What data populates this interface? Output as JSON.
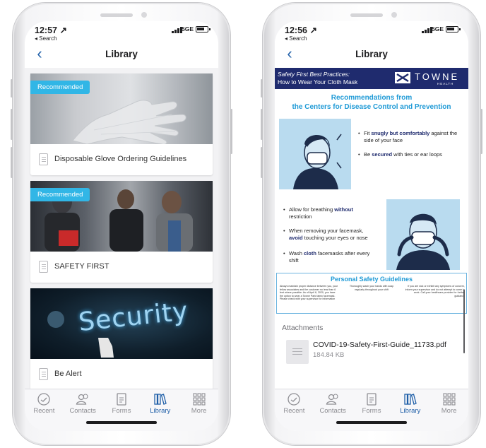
{
  "left_screen": {
    "status": {
      "time": "12:57 ↗",
      "back_app": "◂ Search",
      "network": "5GE"
    },
    "nav": {
      "title": "Library"
    },
    "cards": [
      {
        "badge": "Recommended",
        "title": "Disposable Glove Ordering Guidelines"
      },
      {
        "badge": "Recommended",
        "title": "SAFETY FIRST"
      },
      {
        "badge": "",
        "image_text": "Security",
        "title": "Be Alert"
      }
    ]
  },
  "right_screen": {
    "status": {
      "time": "12:56 ↗",
      "back_app": "◂ Search",
      "network": "5GE"
    },
    "nav": {
      "title": "Library"
    },
    "document": {
      "banner_line1": "Safety First Best Practices:",
      "banner_line2": "How to Wear Your Cloth Mask",
      "logo_text": "TOWNE",
      "logo_sub": "HEALTH",
      "heading_line1": "Recommendations from",
      "heading_line2": "the Centers for Disease Control and Prevention",
      "bullet1_pre": "Fit ",
      "bullet1_bold": "snugly but comfortably",
      "bullet1_post": " against the side of your face",
      "bullet2_pre": "Be ",
      "bullet2_bold": "secured",
      "bullet2_post": " with ties or ear loops",
      "bullet3_pre": "Allow for breathing ",
      "bullet3_bold": "without",
      "bullet3_post": " restriction",
      "bullet4_pre": "When removing your facemask, ",
      "bullet4_bold": "avoid",
      "bullet4_post": " touching your eyes or nose",
      "bullet5_pre": "Wash ",
      "bullet5_bold": "cloth",
      "bullet5_post": " facemasks after every shift",
      "psg_title": "Personal Safety Guidelines",
      "psg_col1": "Always maintain proper distance between you, your fellow associates and the customer no less than 6 feet where possible. As of April 6, 2020, you have the option to wear a Towne Park fabric facemask. Please check with your supervisor for information",
      "psg_col2": "Thoroughly wash your hands with soap regularly throughout your shift",
      "psg_col3": "If you are sick or exhibit any symptoms of concern, inform your supervisor and do not attempt to come to work. Call your healthcare provider for further guidance"
    },
    "attachments": {
      "label": "Attachments",
      "file_name": "COVID-19-Safety-First-Guide_11733.pdf",
      "file_size": "184.84 KB"
    }
  },
  "tabs": [
    {
      "label": "Recent",
      "icon": "clock-icon"
    },
    {
      "label": "Contacts",
      "icon": "contacts-icon"
    },
    {
      "label": "Forms",
      "icon": "form-icon"
    },
    {
      "label": "Library",
      "icon": "library-icon",
      "active": true
    },
    {
      "label": "More",
      "icon": "grid-icon"
    }
  ],
  "colors": {
    "accent": "#1f5fa8",
    "badge": "#31b6e6",
    "doc_banner": "#1f2b6e",
    "doc_heading": "#1f9ad6"
  }
}
